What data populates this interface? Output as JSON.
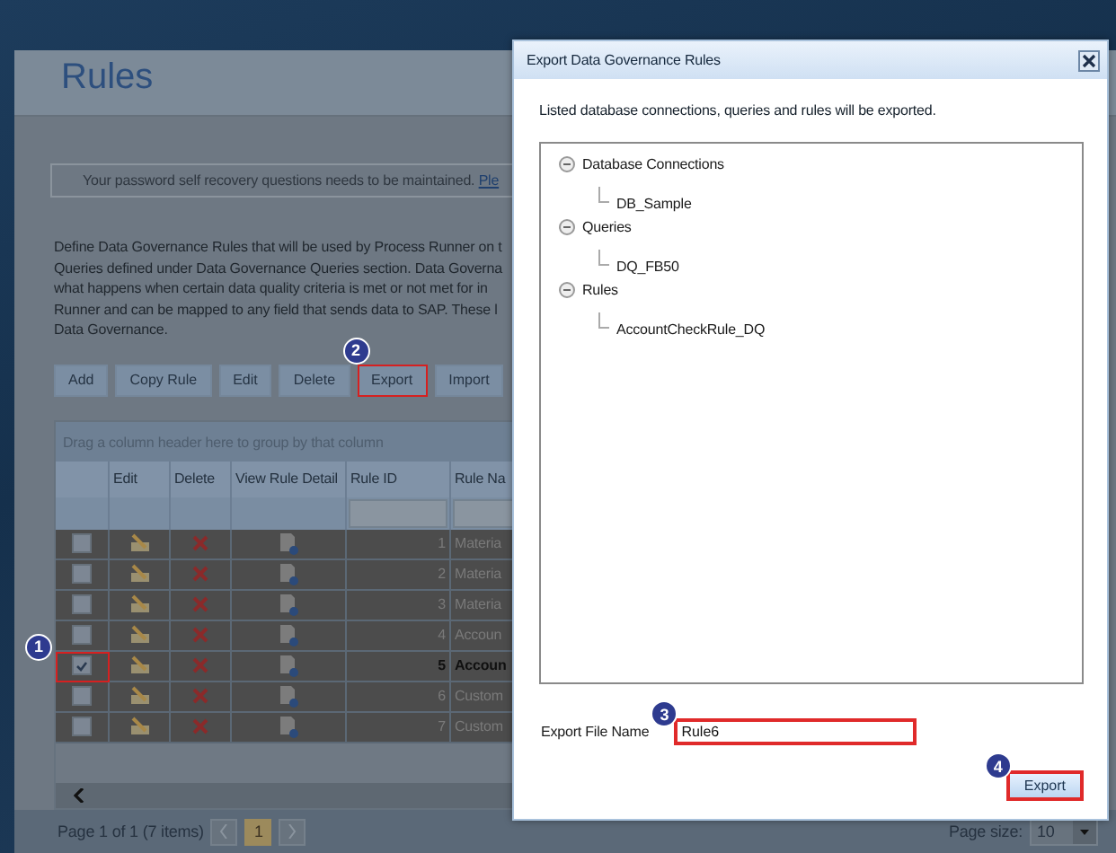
{
  "window": {
    "title": "Rules"
  },
  "notice": {
    "text": "Your password self recovery questions needs to be maintained. ",
    "link": "Ple"
  },
  "description": [
    "Define Data Governance Rules that will be used by Process Runner on t",
    "Queries defined under Data Governance Queries section. Data Governa",
    "what happens when certain data quality criteria is met or not met for in",
    "Runner and can be mapped to any field that sends data to SAP. These l",
    "Data Governance."
  ],
  "toolbar": [
    {
      "label": "Add",
      "highlighted": false
    },
    {
      "label": "Copy Rule",
      "highlighted": false
    },
    {
      "label": "Edit",
      "highlighted": false
    },
    {
      "label": "Delete",
      "highlighted": false
    },
    {
      "label": "Export",
      "highlighted": true,
      "marker": "2"
    },
    {
      "label": "Import",
      "highlighted": false
    }
  ],
  "grid": {
    "group_hint": "Drag a column header here to group by that column",
    "columns": [
      "Edit",
      "Delete",
      "View Rule Detail",
      "Rule ID",
      "Rule Na"
    ],
    "rows": [
      {
        "id": "1",
        "name": "Materia",
        "checked": false,
        "selected": false,
        "highlighted": false
      },
      {
        "id": "2",
        "name": "Materia",
        "checked": false,
        "selected": false,
        "highlighted": false
      },
      {
        "id": "3",
        "name": "Materia",
        "checked": false,
        "selected": false,
        "highlighted": false
      },
      {
        "id": "4",
        "name": "Accoun",
        "checked": false,
        "selected": false,
        "highlighted": false
      },
      {
        "id": "5",
        "name": "Accoun",
        "checked": true,
        "selected": true,
        "highlighted": true,
        "marker": "1"
      },
      {
        "id": "6",
        "name": "Custom",
        "checked": false,
        "selected": false,
        "highlighted": false
      },
      {
        "id": "7",
        "name": "Custom",
        "checked": false,
        "selected": false,
        "highlighted": false
      }
    ],
    "pager": {
      "summary": "Page 1 of 1 (7 items)",
      "page": "1",
      "page_size_label": "Page size:",
      "page_size": "10"
    }
  },
  "dialog": {
    "title": "Export Data Governance Rules",
    "message": "Listed database connections, queries and rules will be exported.",
    "tree": [
      {
        "label": "Database Connections",
        "expanded": true,
        "children": [
          {
            "label": "DB_Sample"
          }
        ]
      },
      {
        "label": "Queries",
        "expanded": true,
        "children": [
          {
            "label": "DQ_FB50"
          }
        ]
      },
      {
        "label": "Rules",
        "expanded": true,
        "children": [
          {
            "label": "AccountCheckRule_DQ"
          }
        ]
      }
    ],
    "file_name_label": "Export File Name",
    "file_name": "Rule6",
    "file_name_highlighted": true,
    "file_name_marker": "3",
    "button": {
      "label": "Export",
      "highlighted": true,
      "marker": "4"
    }
  }
}
